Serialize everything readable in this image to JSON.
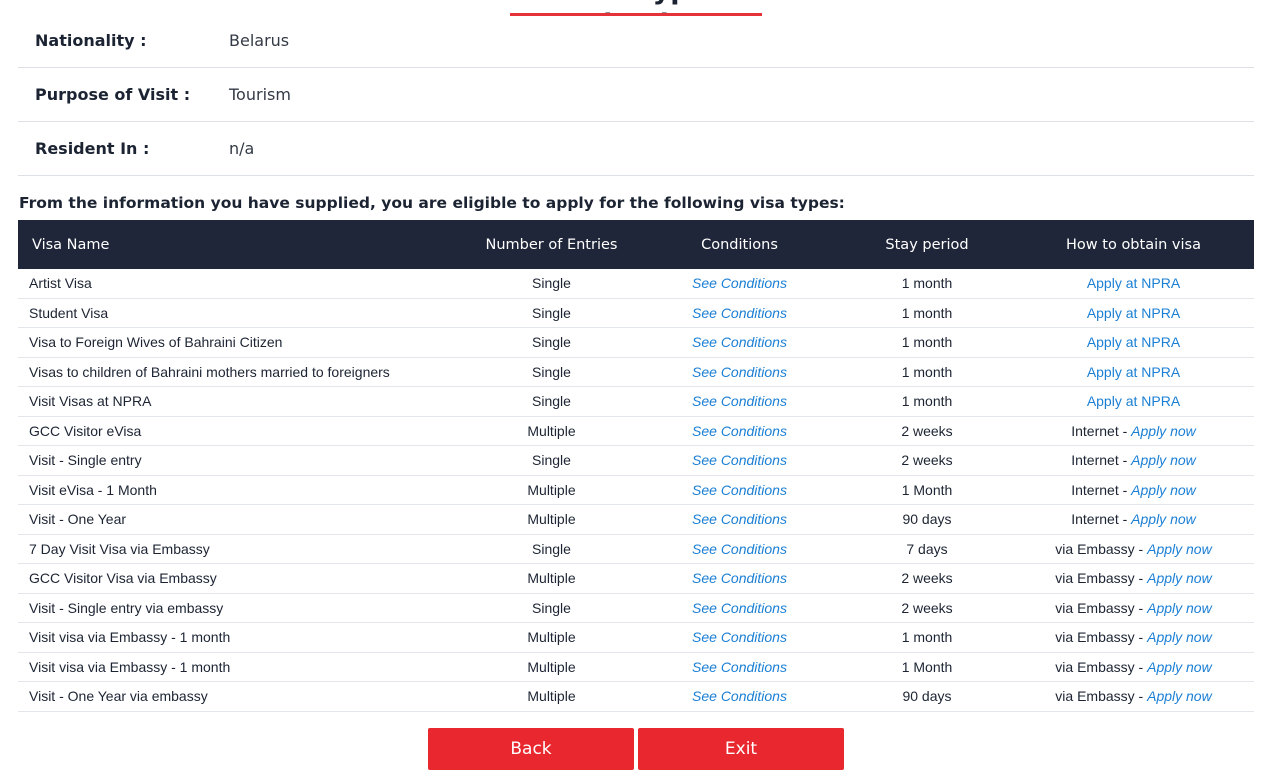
{
  "header": {
    "title": "Visa Type Selection"
  },
  "applicant": {
    "nationality": {
      "label": "Nationality :",
      "value": "Belarus"
    },
    "purpose": {
      "label": "Purpose of Visit :",
      "value": "Tourism"
    },
    "resident": {
      "label": "Resident In :",
      "value": "n/a"
    }
  },
  "eligible_text": "From the information you have supplied, you are eligible to apply for the following visa types:",
  "table": {
    "headers": [
      "Visa Name",
      "Number of Entries",
      "Conditions",
      "Stay period",
      "How to obtain visa"
    ],
    "rows": [
      {
        "name": "Artist Visa",
        "entries": "Single",
        "conditions": "See Conditions",
        "stay": "1 month",
        "obtain_prefix": "",
        "obtain_link": "Apply at NPRA"
      },
      {
        "name": "Student Visa",
        "entries": "Single",
        "conditions": "See Conditions",
        "stay": "1 month",
        "obtain_prefix": "",
        "obtain_link": "Apply at NPRA"
      },
      {
        "name": "Visa to Foreign Wives of Bahraini Citizen",
        "entries": "Single",
        "conditions": "See Conditions",
        "stay": "1 month",
        "obtain_prefix": "",
        "obtain_link": "Apply at NPRA"
      },
      {
        "name": "Visas to children of Bahraini mothers married to foreigners",
        "entries": "Single",
        "conditions": "See Conditions",
        "stay": "1 month",
        "obtain_prefix": "",
        "obtain_link": "Apply at NPRA"
      },
      {
        "name": "Visit Visas at NPRA",
        "entries": "Single",
        "conditions": "See Conditions",
        "stay": "1 month",
        "obtain_prefix": "",
        "obtain_link": "Apply at NPRA"
      },
      {
        "name": "GCC Visitor eVisa",
        "entries": "Multiple",
        "conditions": "See Conditions",
        "stay": "2 weeks",
        "obtain_prefix": "Internet - ",
        "obtain_link": "Apply now"
      },
      {
        "name": "Visit - Single entry",
        "entries": "Single",
        "conditions": "See Conditions",
        "stay": "2 weeks",
        "obtain_prefix": "Internet - ",
        "obtain_link": "Apply now"
      },
      {
        "name": "Visit eVisa - 1 Month",
        "entries": "Multiple",
        "conditions": "See Conditions",
        "stay": "1 Month",
        "obtain_prefix": "Internet - ",
        "obtain_link": "Apply now"
      },
      {
        "name": "Visit - One Year",
        "entries": "Multiple",
        "conditions": "See Conditions",
        "stay": "90 days",
        "obtain_prefix": "Internet - ",
        "obtain_link": "Apply now"
      },
      {
        "name": "7 Day Visit Visa via Embassy",
        "entries": "Single",
        "conditions": "See Conditions",
        "stay": "7 days",
        "obtain_prefix": "via Embassy - ",
        "obtain_link": "Apply now"
      },
      {
        "name": "GCC Visitor Visa via Embassy",
        "entries": "Multiple",
        "conditions": "See Conditions",
        "stay": "2 weeks",
        "obtain_prefix": "via Embassy - ",
        "obtain_link": "Apply now"
      },
      {
        "name": "Visit - Single entry via embassy",
        "entries": "Single",
        "conditions": "See Conditions",
        "stay": "2 weeks",
        "obtain_prefix": "via Embassy - ",
        "obtain_link": "Apply now"
      },
      {
        "name": "Visit visa via Embassy - 1 month",
        "entries": "Multiple",
        "conditions": "See Conditions",
        "stay": "1 month",
        "obtain_prefix": "via Embassy - ",
        "obtain_link": "Apply now"
      },
      {
        "name": "Visit visa via Embassy - 1 month",
        "entries": "Multiple",
        "conditions": "See Conditions",
        "stay": "1 Month",
        "obtain_prefix": "via Embassy - ",
        "obtain_link": "Apply now"
      },
      {
        "name": "Visit - One Year via embassy",
        "entries": "Multiple",
        "conditions": "See Conditions",
        "stay": "90 days",
        "obtain_prefix": "via Embassy - ",
        "obtain_link": "Apply now"
      }
    ]
  },
  "buttons": {
    "back": "Back",
    "exit": "Exit"
  },
  "colors": {
    "accent_red": "#e8272e",
    "header_navy": "#1f2639",
    "link_blue": "#1b7fd4"
  }
}
